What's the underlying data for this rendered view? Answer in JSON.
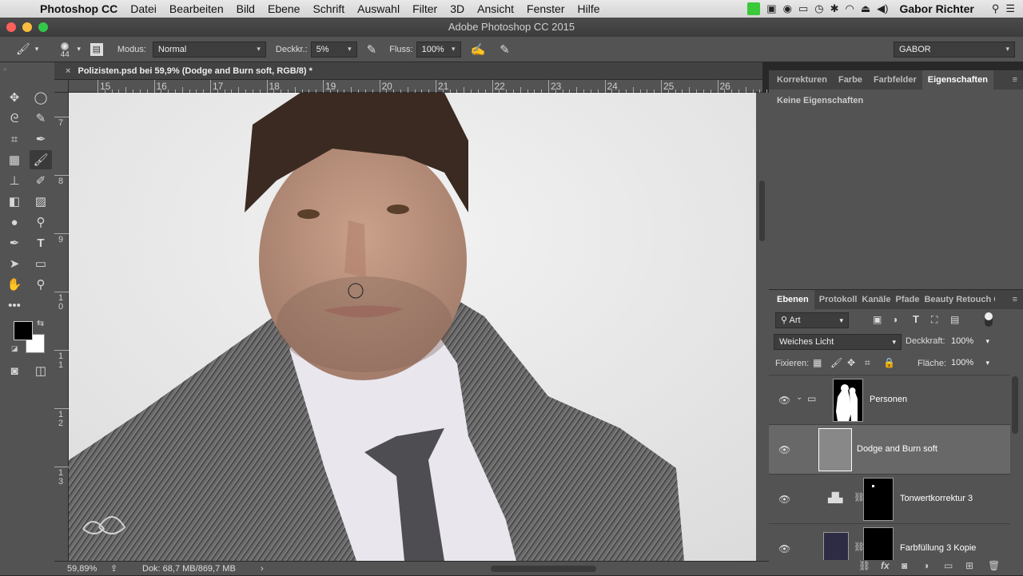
{
  "menubar": {
    "app": "Photoshop CC",
    "items": [
      "Datei",
      "Bearbeiten",
      "Bild",
      "Ebene",
      "Schrift",
      "Auswahl",
      "Filter",
      "3D",
      "Ansicht",
      "Fenster",
      "Hilfe"
    ],
    "user": "Gabor Richter"
  },
  "window": {
    "title": "Adobe Photoshop CC 2015"
  },
  "options": {
    "brush_size": "44",
    "modus_label": "Modus:",
    "modus_value": "Normal",
    "deckkr_label": "Deckkr.:",
    "deckkr_value": "5%",
    "fluss_label": "Fluss:",
    "fluss_value": "100%",
    "workspace": "GABOR"
  },
  "document": {
    "tab_title": "Polizisten.psd bei 59,9% (Dodge and Burn soft, RGB/8) *",
    "zoom": "59,89%",
    "doc_info": "Dok: 68,7 MB/869,7 MB"
  },
  "rulers": {
    "h": [
      "15",
      "16",
      "17",
      "18",
      "19",
      "20",
      "21",
      "22",
      "23",
      "24",
      "25",
      "26"
    ],
    "v": [
      "7",
      "8",
      "9",
      "1 0",
      "1 1",
      "1 2",
      "1 3"
    ]
  },
  "props_panel": {
    "tabs": [
      "Korrekturen",
      "Farbe",
      "Farbfelder",
      "Eigenschaften"
    ],
    "active": "Eigenschaften",
    "empty_text": "Keine Eigenschaften"
  },
  "layers_panel": {
    "tabs": [
      "Ebenen",
      "Protokoll",
      "Kanäle",
      "Pfade",
      "Beauty Retouch C"
    ],
    "active": "Ebenen",
    "filter": "Art",
    "blend_mode": "Weiches Licht",
    "deckkraft_label": "Deckkraft:",
    "deckkraft_value": "100%",
    "fixieren_label": "Fixieren:",
    "flaeche_label": "Fläche:",
    "flaeche_value": "100%",
    "layers": [
      {
        "name": "Personen",
        "type": "group"
      },
      {
        "name": "Dodge and Burn soft",
        "type": "pixel",
        "selected": true
      },
      {
        "name": "Tonwertkorrektur 3",
        "type": "adjustment"
      },
      {
        "name": "Farbfüllung 3 Kopie",
        "type": "fill"
      }
    ]
  },
  "colors": {
    "accent": "#535353",
    "selected_layer": "#686868",
    "traffic_red": "#fc605b",
    "traffic_yellow": "#fdbc40",
    "traffic_green": "#34c84a"
  }
}
